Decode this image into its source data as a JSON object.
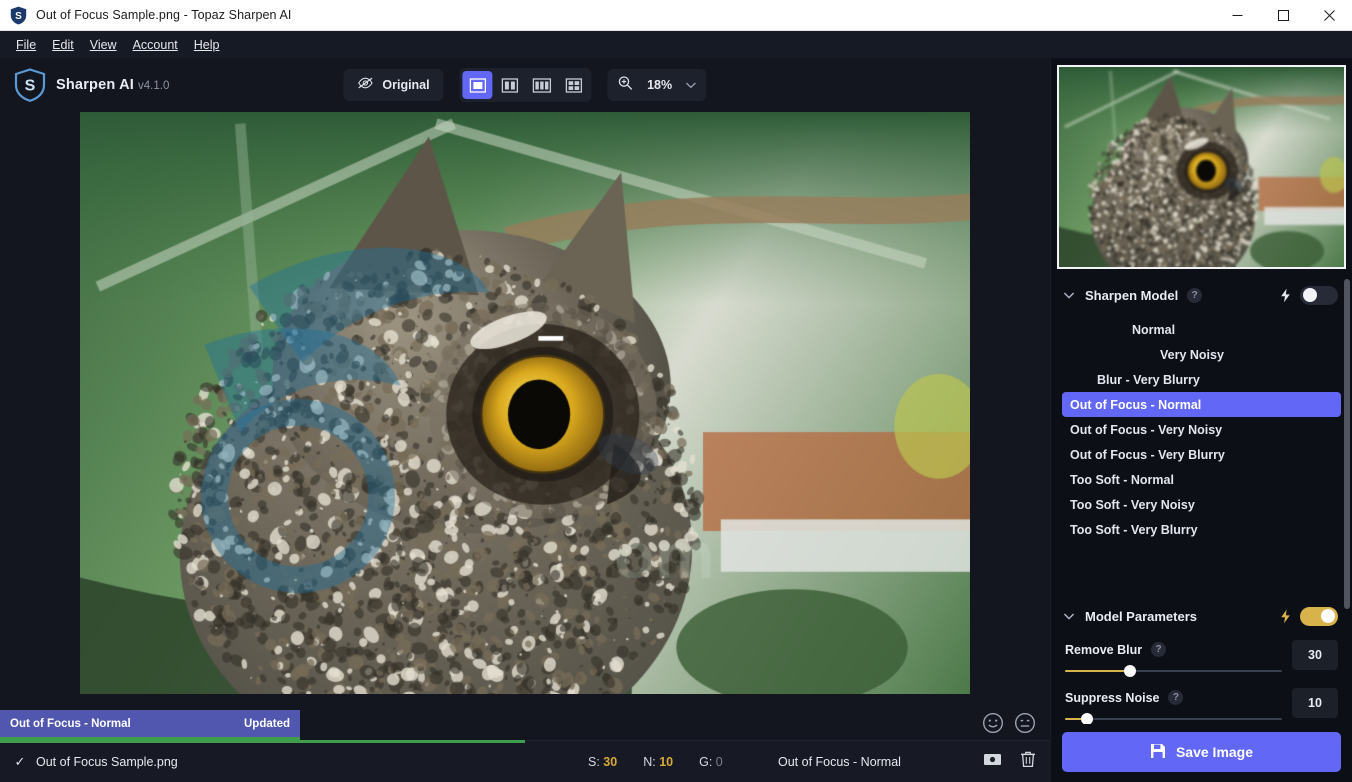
{
  "window": {
    "title": "Out of Focus Sample.png - Topaz Sharpen AI",
    "logo_icon": "topaz-shield-icon",
    "minimize_icon": "minimize-icon",
    "maximize_icon": "maximize-icon",
    "close_icon": "close-icon"
  },
  "menubar": {
    "items": [
      {
        "label": "File",
        "accel": "F"
      },
      {
        "label": "Edit",
        "accel": "E"
      },
      {
        "label": "View",
        "accel": "V"
      },
      {
        "label": "Account",
        "accel": "A"
      },
      {
        "label": "Help",
        "accel": "H"
      }
    ]
  },
  "toolbar": {
    "brand_name": "Sharpen AI",
    "brand_version": "v4.1.0",
    "brand_icon": "topaz-shield-icon",
    "original_label": "Original",
    "original_icon": "eye-off-icon",
    "view_modes": [
      {
        "name": "single-view",
        "icon": "single-pane-icon",
        "active": true
      },
      {
        "name": "split-view",
        "icon": "two-pane-icon",
        "active": false
      },
      {
        "name": "three-pane-view",
        "icon": "three-pane-icon",
        "active": false
      },
      {
        "name": "quad-view",
        "icon": "four-pane-grid-icon",
        "active": false
      }
    ],
    "zoom_icon": "magnifier-plus-icon",
    "zoom_value": "18%",
    "zoom_chevron_icon": "chevron-down-icon"
  },
  "canvas": {
    "feedback_positive_icon": "smiley-happy-icon",
    "feedback_negative_icon": "smiley-neutral-icon",
    "toast": {
      "model": "Out of Focus - Normal",
      "status": "Updated"
    }
  },
  "statusbar": {
    "checkmark_icon": "check-icon",
    "filename": "Out of Focus Sample.png",
    "metrics": [
      {
        "key": "S:",
        "value": "30",
        "style": "gold"
      },
      {
        "key": "N:",
        "value": "10",
        "style": "gold"
      },
      {
        "key": "G:",
        "value": "0",
        "style": "dim"
      }
    ],
    "model": "Out of Focus - Normal",
    "compare_icon": "image-compare-icon",
    "delete_icon": "trash-icon",
    "progress_percent": 50
  },
  "right_panel": {
    "preview_image_alt": "owl-preview-thumbnail",
    "sharpen_model": {
      "title": "Sharpen Model",
      "help_icon": "question-mark-icon",
      "chevron_icon": "chevron-down-icon",
      "bolt_icon": "lightning-bolt-icon",
      "auto_toggle_on": false,
      "items": [
        {
          "label": "Normal",
          "selected": false,
          "clipped": "center"
        },
        {
          "label": "Very Noisy",
          "selected": false,
          "clipped": "off2"
        },
        {
          "label": "Blur - Very Blurry",
          "selected": false,
          "clipped": "off3"
        },
        {
          "label": "Out of Focus - Normal",
          "selected": true,
          "clipped": "none"
        },
        {
          "label": "Out of Focus - Very Noisy",
          "selected": false,
          "clipped": "none"
        },
        {
          "label": "Out of Focus - Very Blurry",
          "selected": false,
          "clipped": "none"
        },
        {
          "label": "Too Soft - Normal",
          "selected": false,
          "clipped": "none"
        },
        {
          "label": "Too Soft - Very Noisy",
          "selected": false,
          "clipped": "none"
        },
        {
          "label": "Too Soft - Very Blurry",
          "selected": false,
          "clipped": "none"
        }
      ]
    },
    "model_parameters": {
      "title": "Model Parameters",
      "chevron_icon": "chevron-down-icon",
      "bolt_icon": "lightning-bolt-icon",
      "auto_toggle_on": true,
      "params": [
        {
          "label": "Remove Blur",
          "help_icon": "question-mark-icon",
          "value": "30",
          "percent": 30
        },
        {
          "label": "Suppress Noise",
          "help_icon": "question-mark-icon",
          "value": "10",
          "percent": 10
        }
      ]
    },
    "save_button": {
      "label": "Save Image",
      "icon": "floppy-disk-icon"
    }
  },
  "colors": {
    "accent_indigo": "#6268f5",
    "accent_gold": "#d8b24b",
    "progress_green": "#3f9e4d",
    "panel_bg": "#0d0f17",
    "toolbar_bg": "#13161f"
  }
}
